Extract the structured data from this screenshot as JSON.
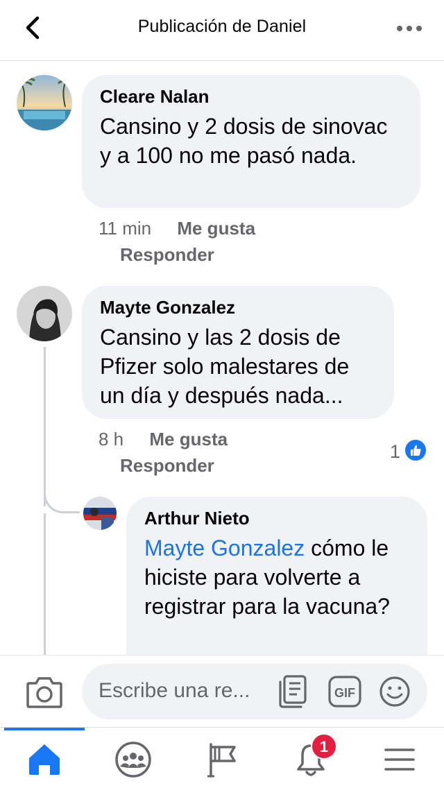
{
  "header": {
    "title": "Publicación de Daniel"
  },
  "comments": [
    {
      "author": "Cleare Nalan",
      "text": "Cansino y 2 dosis de sinovac y a 100 no me pasó nada.",
      "time": "11 min",
      "like_label": "Me gusta",
      "reply_label": "Responder"
    },
    {
      "author": "Mayte Gonzalez",
      "text": "Cansino y las 2 dosis de Pfizer solo malestares de un día y después nada...",
      "time": "8 h",
      "like_label": "Me gusta",
      "reply_label": "Responder",
      "reaction_count": "1"
    }
  ],
  "reply": {
    "author": "Arthur Nieto",
    "mention": "Mayte Gonzalez",
    "text": " cómo le hiciste para volverte a registrar para la vacuna?"
  },
  "composer": {
    "placeholder": "Escribe una re..."
  },
  "tabbar": {
    "notification_count": "1"
  },
  "colors": {
    "accent": "#1877f2",
    "mention": "#1b74e4",
    "badge": "#e41e3f",
    "bubble": "#f0f2f5",
    "muted": "#65676b"
  },
  "icons": [
    "back-arrow-icon",
    "more-dots-icon",
    "camera-icon",
    "sticker-icon",
    "gif-icon",
    "emoji-icon",
    "home-icon",
    "groups-icon",
    "pages-flag-icon",
    "bell-icon",
    "menu-icon",
    "like-icon"
  ]
}
